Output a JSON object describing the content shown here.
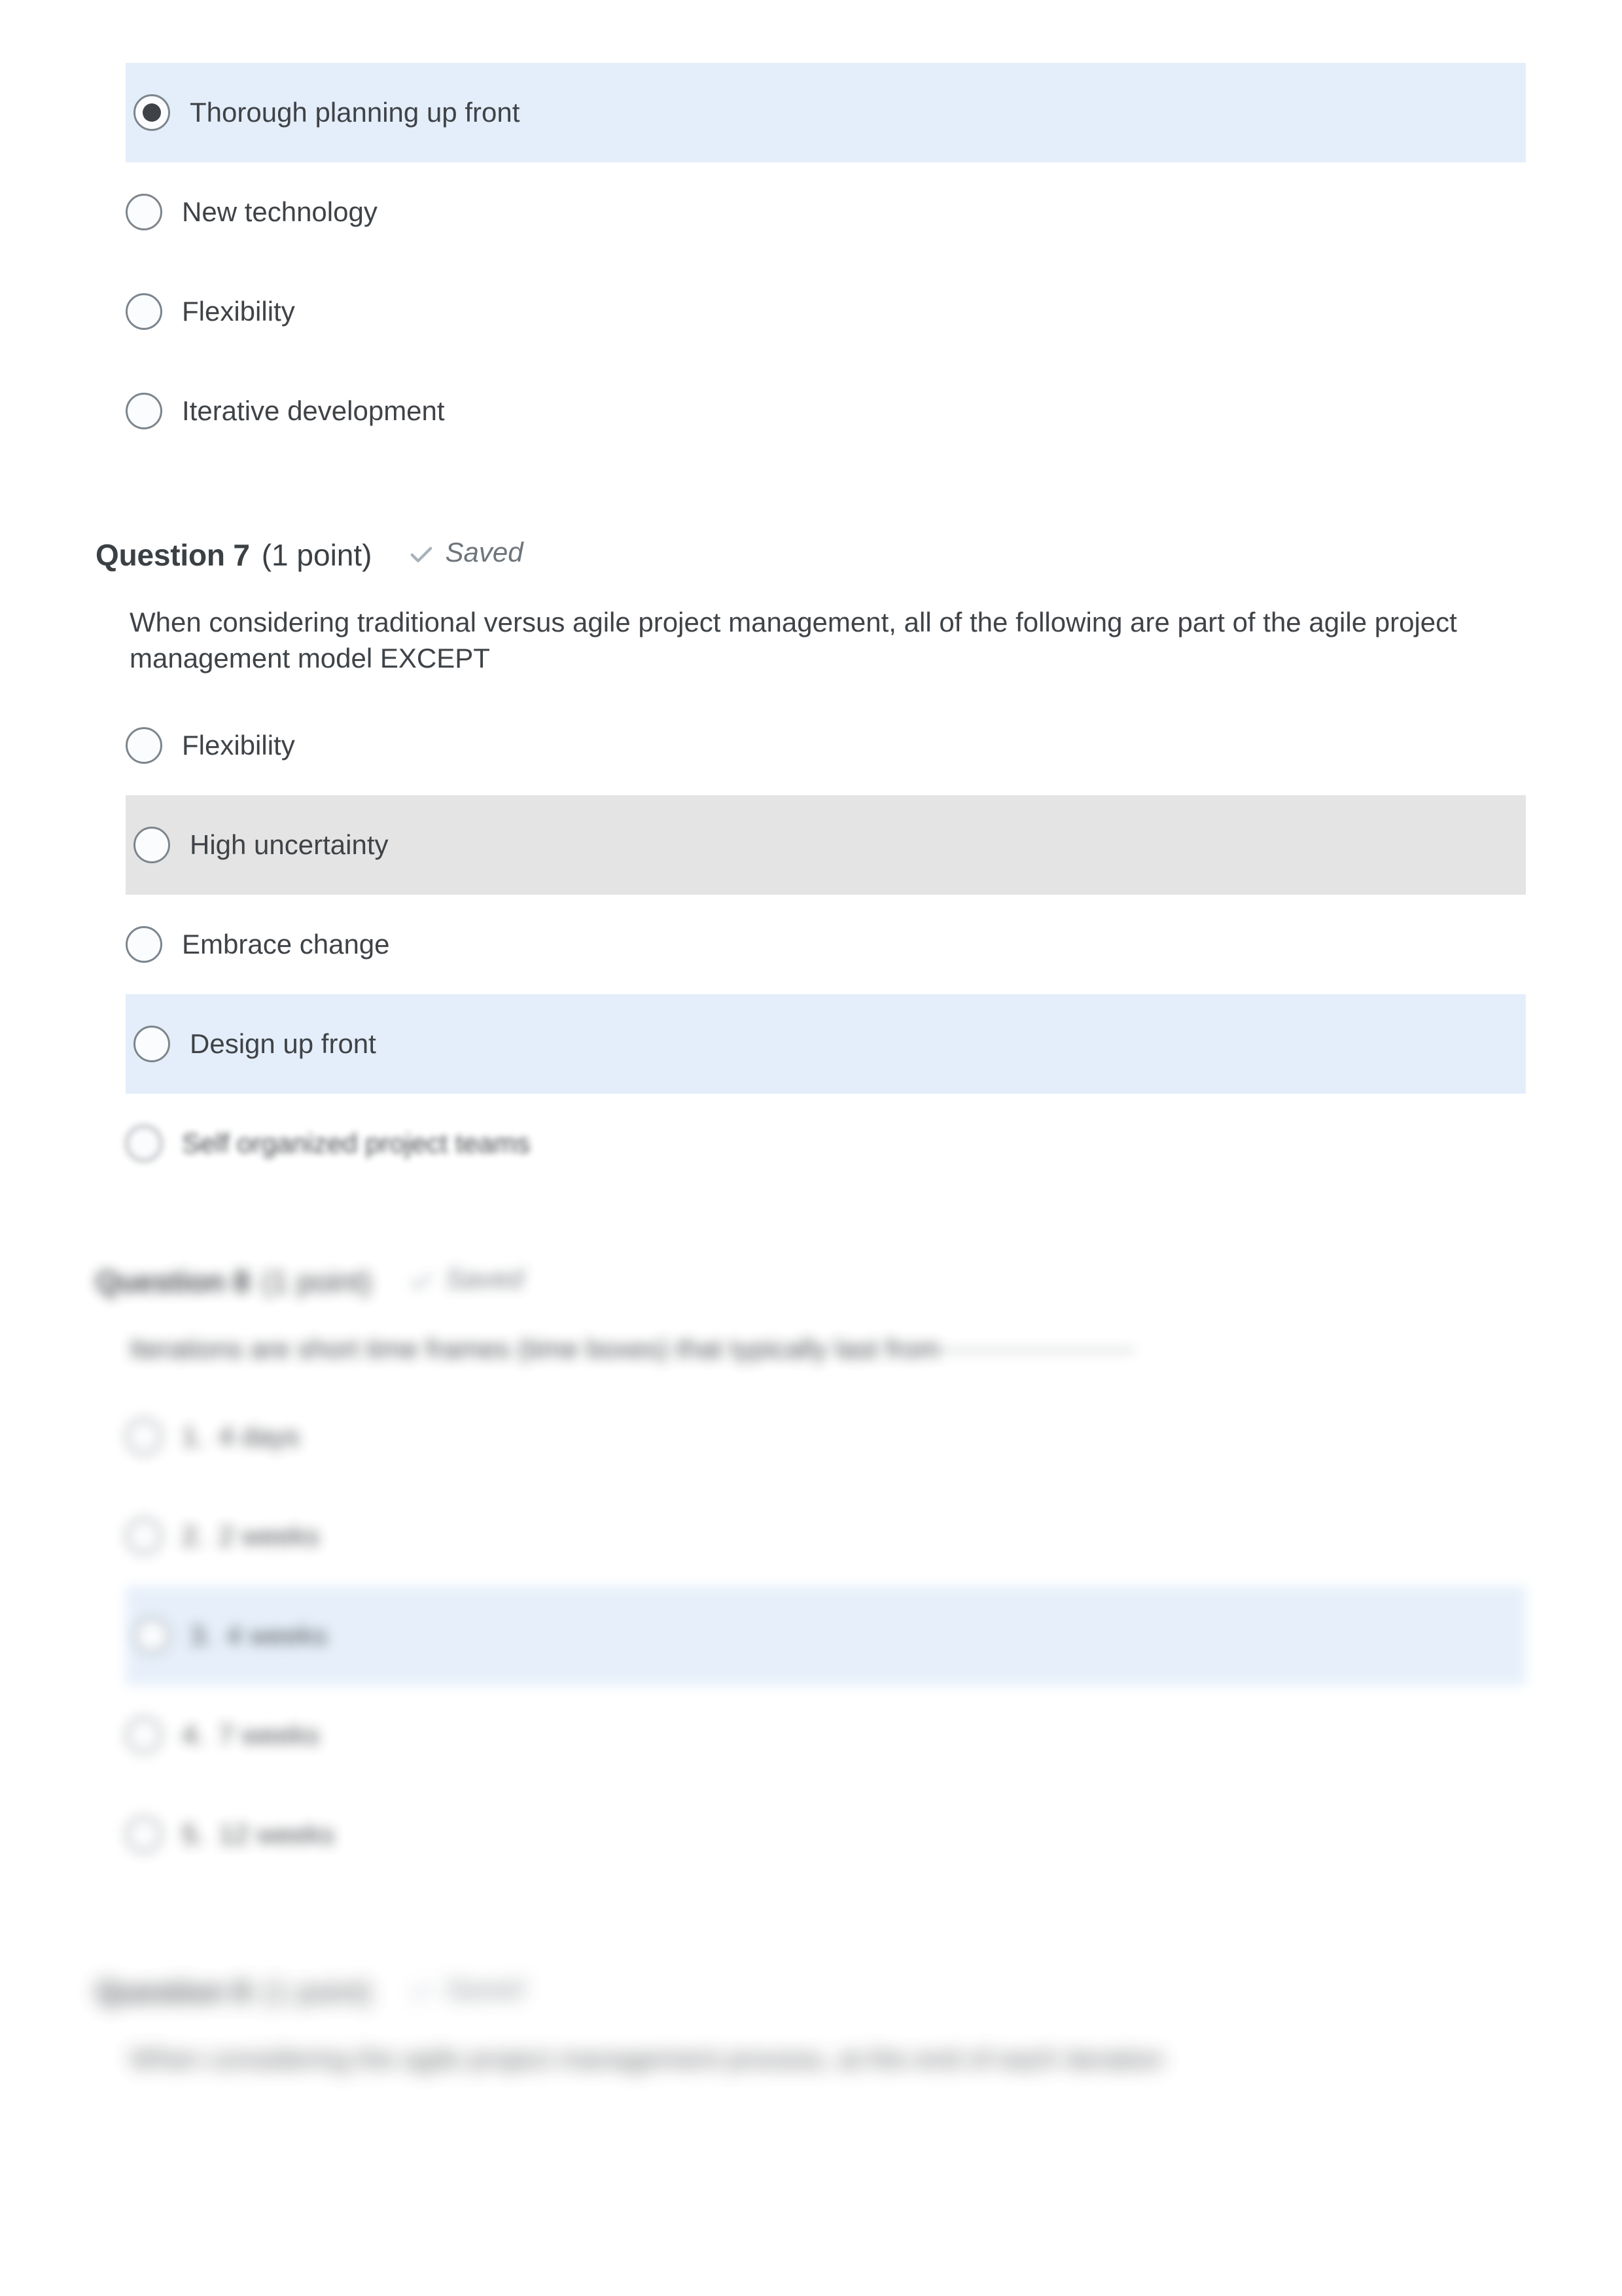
{
  "page": {
    "background": "#ffffff",
    "text_color": "#3f4347",
    "highlight_selected_color": "#e4eefa",
    "highlight_hover_color": "#e4e4e4",
    "radio_border_color": "#7d858c"
  },
  "question6_tail": {
    "options": [
      {
        "num": "",
        "label": "Thorough planning up front",
        "selected": true,
        "highlight": "blue"
      },
      {
        "num": "",
        "label": "New technology",
        "selected": false,
        "highlight": "none"
      },
      {
        "num": "",
        "label": "Flexibility",
        "selected": false,
        "highlight": "none"
      },
      {
        "num": "",
        "label": "Iterative development",
        "selected": false,
        "highlight": "none"
      }
    ]
  },
  "question7": {
    "title": "Question 7",
    "points": "(1 point)",
    "saved_label": "Saved",
    "saved_icon": "check-icon",
    "text": "When considering traditional versus agile project management, all of the following are part of the agile project management model EXCEPT",
    "options": [
      {
        "num": "",
        "label": "Flexibility",
        "selected": false,
        "highlight": "none"
      },
      {
        "num": "",
        "label": "High uncertainty",
        "selected": false,
        "highlight": "gray"
      },
      {
        "num": "",
        "label": "Embrace change",
        "selected": false,
        "highlight": "none"
      },
      {
        "num": "",
        "label": "Design up front",
        "selected": false,
        "highlight": "blue"
      },
      {
        "num": "",
        "label": "Self organized project teams",
        "selected": false,
        "highlight": "none"
      }
    ]
  },
  "question8": {
    "title": "Question 8",
    "points": "(1 point)",
    "saved_label": "Saved",
    "saved_icon": "check-icon",
    "text": "Iterations are short time frames (time boxes) that typically last from",
    "options": [
      {
        "num": "1.",
        "label": "4 days",
        "selected": false,
        "highlight": "none"
      },
      {
        "num": "2.",
        "label": "2 weeks",
        "selected": false,
        "highlight": "none"
      },
      {
        "num": "3.",
        "label": "4 weeks",
        "selected": false,
        "highlight": "blue"
      },
      {
        "num": "4.",
        "label": "7 weeks",
        "selected": false,
        "highlight": "none"
      },
      {
        "num": "5.",
        "label": "12 weeks",
        "selected": false,
        "highlight": "none"
      }
    ]
  },
  "question9": {
    "title": "Question 9",
    "points": "(1 point)",
    "saved_label": "Saved",
    "saved_icon": "check-icon",
    "text": "When considering the agile project management process, at the end of each iteration"
  }
}
